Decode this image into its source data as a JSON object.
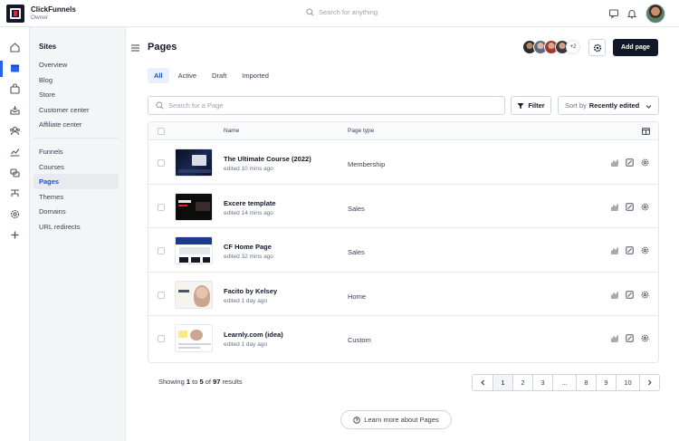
{
  "app": {
    "name": "ClickFunnels",
    "role": "Owner"
  },
  "topbar": {
    "search_placeholder": "Search for anything"
  },
  "sidenav": {
    "header": "Sites",
    "group1": [
      "Overview",
      "Blog",
      "Store",
      "Customer center",
      "Affiliate center"
    ],
    "group2": [
      "Funnels",
      "Courses",
      "Pages",
      "Themes",
      "Domains",
      "URL redirects"
    ],
    "selected": "Pages"
  },
  "main": {
    "title": "Pages",
    "team_more": "+2",
    "add_label": "Add page",
    "tabs": [
      "All",
      "Active",
      "Draft",
      "Imported"
    ],
    "active_tab": "All",
    "search_placeholder": "Search for a Page",
    "filter_label": "Filter",
    "sort_prefix": "Sort by",
    "sort_value": "Recently edited",
    "columns": {
      "name": "Name",
      "type": "Page type"
    },
    "rows": [
      {
        "name": "The Ultimate Course (2022)",
        "edited": "edited 10 mins ago",
        "type": "Membership"
      },
      {
        "name": "Excere template",
        "edited": "edited 14 mins ago",
        "type": "Sales"
      },
      {
        "name": "CF Home Page",
        "edited": "edited 32 mins ago",
        "type": "Sales"
      },
      {
        "name": "Facito by Kelsey",
        "edited": "edited 1 day ago",
        "type": "Home"
      },
      {
        "name": "Learnly.com (idea)",
        "edited": "edited 1 day ago",
        "type": "Custom"
      }
    ],
    "showing": {
      "prefix": "Showing",
      "from": "1",
      "to_word": "to",
      "to": "5",
      "of_word": "of",
      "total": "97",
      "suffix": "results"
    },
    "pages": [
      "1",
      "2",
      "3",
      "...",
      "8",
      "9",
      "10"
    ],
    "current_page": "1",
    "learn_more": "Learn more about Pages"
  },
  "colors": {
    "accent": "#2563eb",
    "primary_button": "#111827",
    "tab_active_bg": "#e8efff"
  }
}
